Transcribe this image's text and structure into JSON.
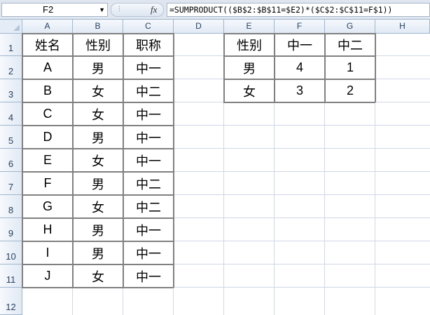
{
  "formula_bar": {
    "name_box": "F2",
    "formula": "=SUMPRODUCT(($B$2:$B$11=$E2)*($C$2:$C$11=F$1))",
    "fx_label": "fx"
  },
  "columns": [
    "A",
    "B",
    "C",
    "D",
    "E",
    "F",
    "G",
    "H"
  ],
  "rows": [
    "1",
    "2",
    "3",
    "4",
    "5",
    "6",
    "7",
    "8",
    "9",
    "10",
    "11",
    "12"
  ],
  "table1": {
    "headers": [
      "姓名",
      "性别",
      "职称"
    ],
    "rows": [
      [
        "A",
        "男",
        "中一"
      ],
      [
        "B",
        "女",
        "中二"
      ],
      [
        "C",
        "女",
        "中一"
      ],
      [
        "D",
        "男",
        "中一"
      ],
      [
        "E",
        "女",
        "中一"
      ],
      [
        "F",
        "男",
        "中二"
      ],
      [
        "G",
        "女",
        "中二"
      ],
      [
        "H",
        "男",
        "中一"
      ],
      [
        "I",
        "男",
        "中一"
      ],
      [
        "J",
        "女",
        "中一"
      ]
    ]
  },
  "table2": {
    "headers": [
      "性别",
      "中一",
      "中二"
    ],
    "rows": [
      [
        "男",
        "4",
        "1"
      ],
      [
        "女",
        "3",
        "2"
      ]
    ]
  },
  "colors": {
    "header_bg": "#e1e9f4",
    "gridline": "#d0d7e5",
    "table_border": "#808080"
  }
}
